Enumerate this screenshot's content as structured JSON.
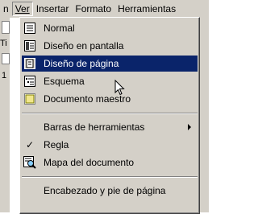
{
  "menubar": {
    "items": [
      {
        "label": "n"
      },
      {
        "label": "Ver"
      },
      {
        "label": "Insertar"
      },
      {
        "label": "Formato"
      },
      {
        "label": "Herramientas"
      }
    ]
  },
  "background": {
    "tab_label": "Ti",
    "ruler_label": "1"
  },
  "menu": {
    "items": [
      {
        "label": "Normal",
        "icon": "normal-view-icon"
      },
      {
        "label": "Diseño en pantalla",
        "icon": "online-layout-icon"
      },
      {
        "label": "Diseño de página",
        "icon": "page-layout-icon",
        "highlighted": true
      },
      {
        "label": "Esquema",
        "icon": "outline-view-icon"
      },
      {
        "label": "Documento maestro",
        "icon": "master-document-icon"
      },
      {
        "label": "Barras de herramientas",
        "submenu": true
      },
      {
        "label": "Regla",
        "checked": true
      },
      {
        "label": "Mapa del documento",
        "icon": "document-map-icon"
      },
      {
        "label": "Encabezado y pie de página"
      }
    ]
  },
  "colors": {
    "menu_face": "#d4d0c8",
    "highlight": "#0a246a",
    "highlight_text": "#ffffff"
  }
}
